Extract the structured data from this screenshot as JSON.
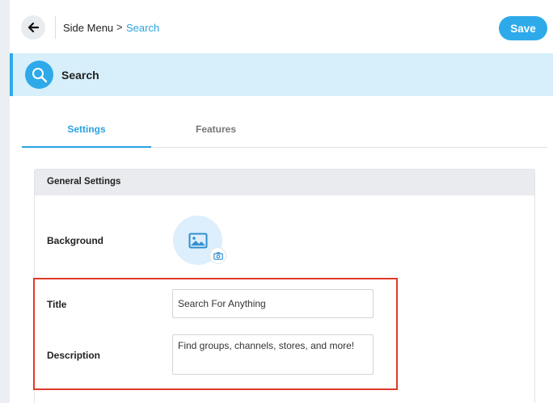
{
  "breadcrumb": {
    "root": "Side Menu",
    "separator": ">",
    "current": "Search"
  },
  "toolbar": {
    "save_label": "Save"
  },
  "header": {
    "title": "Search"
  },
  "tabs": [
    {
      "label": "Settings",
      "active": true
    },
    {
      "label": "Features",
      "active": false
    }
  ],
  "card": {
    "title": "General Settings",
    "background_label": "Background",
    "title_label": "Title",
    "title_value": "Search For Anything",
    "description_label": "Description",
    "description_value": "Find groups, channels, stores, and more!"
  },
  "colors": {
    "accent": "#2eaaea",
    "header_band": "#d6effb",
    "highlight": "#e03a2a"
  }
}
